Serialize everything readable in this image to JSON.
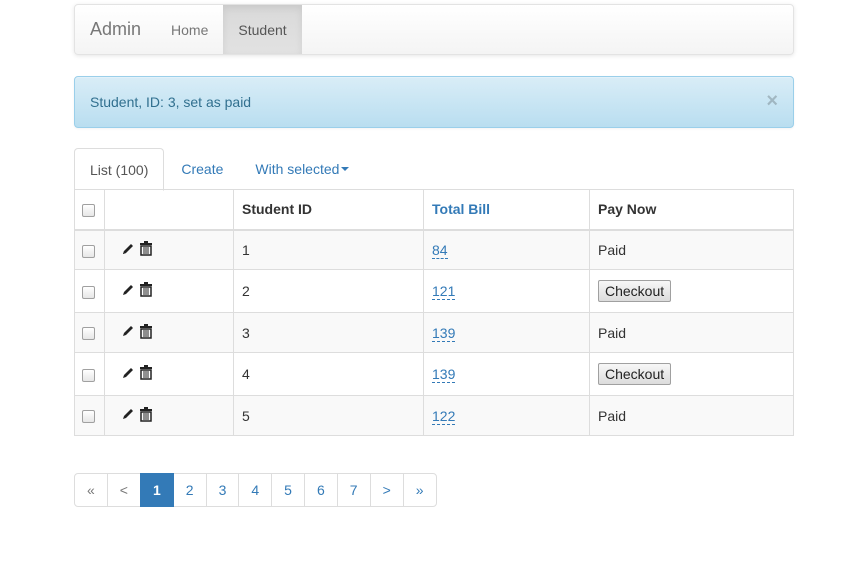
{
  "navbar": {
    "brand": "Admin",
    "items": [
      {
        "label": "Home"
      },
      {
        "label": "Student",
        "active": true
      }
    ]
  },
  "alert": {
    "message": "Student, ID: 3, set as paid",
    "close": "×"
  },
  "tabs": [
    {
      "label": "List (100)",
      "active": true
    },
    {
      "label": "Create"
    },
    {
      "label": "With selected"
    }
  ],
  "table": {
    "columns": [
      "Student ID",
      "Total Bill",
      "Pay Now"
    ],
    "rows": [
      {
        "id": "1",
        "bill": "84",
        "pay": "Paid"
      },
      {
        "id": "2",
        "bill": "121",
        "pay": "Checkout"
      },
      {
        "id": "3",
        "bill": "139",
        "pay": "Paid"
      },
      {
        "id": "4",
        "bill": "139",
        "pay": "Checkout"
      },
      {
        "id": "5",
        "bill": "122",
        "pay": "Paid"
      }
    ]
  },
  "pager": {
    "first": "«",
    "prev": "<",
    "pages": [
      "1",
      "2",
      "3",
      "4",
      "5",
      "6",
      "7"
    ],
    "current": "1",
    "next": ">",
    "last": "»"
  },
  "colors": {
    "link": "#337ab7",
    "alert_bg": "#d9edf7",
    "alert_text": "#31708f"
  },
  "icons": [
    "pencil-icon",
    "trash-icon",
    "close-icon",
    "caret-down-icon"
  ]
}
